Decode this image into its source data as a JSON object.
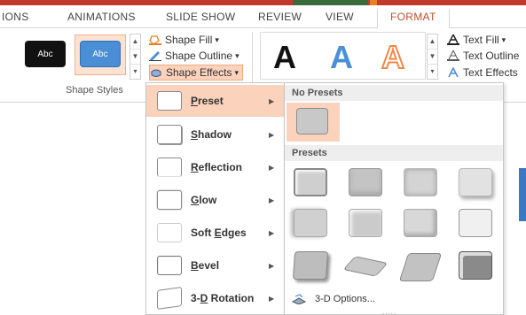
{
  "tabs": [
    "IONS",
    "ANIMATIONS",
    "SLIDE SHOW",
    "REVIEW",
    "VIEW",
    "FORMAT"
  ],
  "shape_styles": {
    "swatch_dark_label": "Abc",
    "swatch_blue_label": "Abc",
    "group_label": "Shape Styles",
    "fill_label": "Shape Fill",
    "outline_label": "Shape Outline",
    "effects_label": "Shape Effects",
    "caret": "▾"
  },
  "wordart": {
    "letter": "A",
    "text_fill_label": "Text Fill",
    "text_outline_label": "Text Outline",
    "text_effects_label": "Text Effects"
  },
  "colors": {
    "accent_orange": "#c0502b",
    "highlight": "#fbd2bc",
    "wordart_blue": "#4a90d9",
    "wordart_orange": "#f0884a"
  },
  "menu": {
    "items": [
      {
        "label": "Preset",
        "accel": "P",
        "rest": "reset"
      },
      {
        "label": "Shadow",
        "accel": "S",
        "rest": "hadow"
      },
      {
        "label": "Reflection",
        "accel": "R",
        "rest": "eflection"
      },
      {
        "label": "Glow",
        "accel": "G",
        "rest": "low"
      },
      {
        "label": "Soft Edges",
        "accel": "E",
        "pre": "Soft ",
        "rest": "dges"
      },
      {
        "label": "Bevel",
        "accel": "B",
        "rest": "evel"
      },
      {
        "label": "3-D Rotation",
        "accel": "D",
        "pre": "3-",
        "rest": " Rotation"
      }
    ]
  },
  "submenu": {
    "no_presets_header": "No Presets",
    "presets_header": "Presets",
    "options_label": "3-D Options...",
    "grip": "....."
  }
}
